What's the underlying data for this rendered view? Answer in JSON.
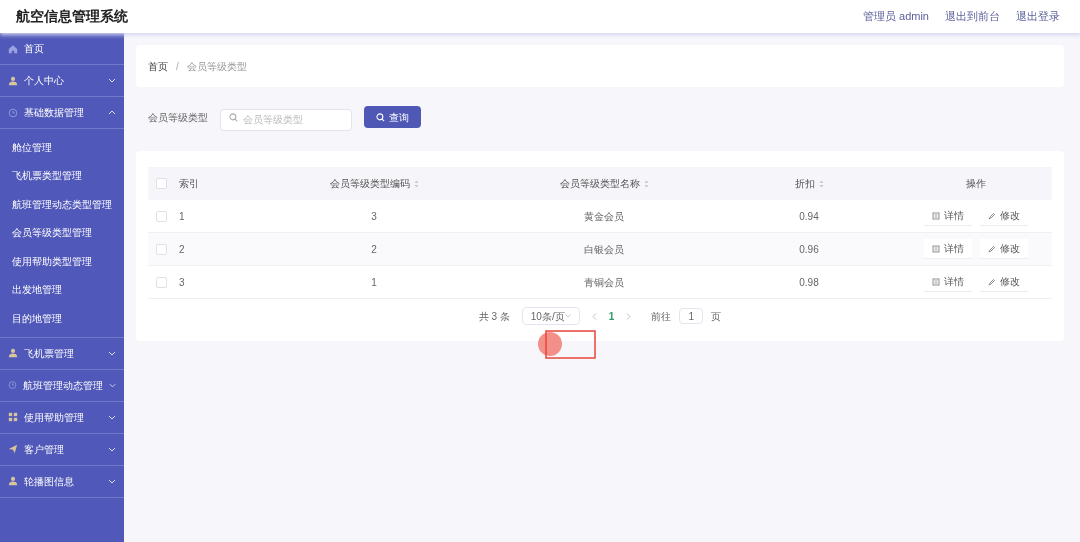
{
  "header": {
    "title": "航空信息管理系统",
    "links": [
      "管理员 admin",
      "退出到前台",
      "退出登录"
    ]
  },
  "sidebar": {
    "items": [
      {
        "label": "首页"
      },
      {
        "label": "个人中心",
        "expanded": false
      },
      {
        "label": "基础数据管理",
        "expanded": true,
        "children": [
          {
            "label": "舱位管理"
          },
          {
            "label": "飞机票类型管理"
          },
          {
            "label": "航班管理动态类型管理"
          },
          {
            "label": "会员等级类型管理"
          },
          {
            "label": "使用帮助类型管理"
          },
          {
            "label": "出发地管理"
          },
          {
            "label": "目的地管理"
          }
        ]
      },
      {
        "label": "飞机票管理",
        "expanded": false
      },
      {
        "label": "航班管理动态管理",
        "expanded": false
      },
      {
        "label": "使用帮助管理",
        "expanded": false
      },
      {
        "label": "客户管理",
        "expanded": false
      },
      {
        "label": "轮播图信息",
        "expanded": false
      }
    ]
  },
  "breadcrumb": {
    "items": [
      "首页",
      "会员等级类型"
    ],
    "separator": "/"
  },
  "search": {
    "label": "会员等级类型",
    "placeholder": "会员等级类型",
    "button": "查询"
  },
  "table": {
    "all_checked": false,
    "columns": [
      {
        "label": "索引",
        "sortable": false
      },
      {
        "label": "会员等级类型编码",
        "sortable": true
      },
      {
        "label": "会员等级类型名称",
        "sortable": true
      },
      {
        "label": "折扣",
        "sortable": true
      },
      {
        "label": "操作",
        "sortable": false
      }
    ],
    "rows": [
      {
        "checked": false,
        "cells": [
          "1",
          "3",
          "黄金会员",
          "0.94"
        ],
        "actions": [
          "详情",
          "修改"
        ]
      },
      {
        "checked": false,
        "cells": [
          "2",
          "2",
          "白银会员",
          "0.96"
        ],
        "actions": [
          "详情",
          "修改"
        ]
      },
      {
        "checked": false,
        "cells": [
          "3",
          "1",
          "青铜会员",
          "0.98"
        ],
        "actions": [
          "详情",
          "修改"
        ]
      }
    ]
  },
  "pagination": {
    "total": "共 3 条",
    "page_size": "10条/页",
    "pages": [
      {
        "label": "1",
        "selected": true
      }
    ],
    "goto_label": "前往",
    "goto_value": "1",
    "goto_suffix": "页"
  }
}
